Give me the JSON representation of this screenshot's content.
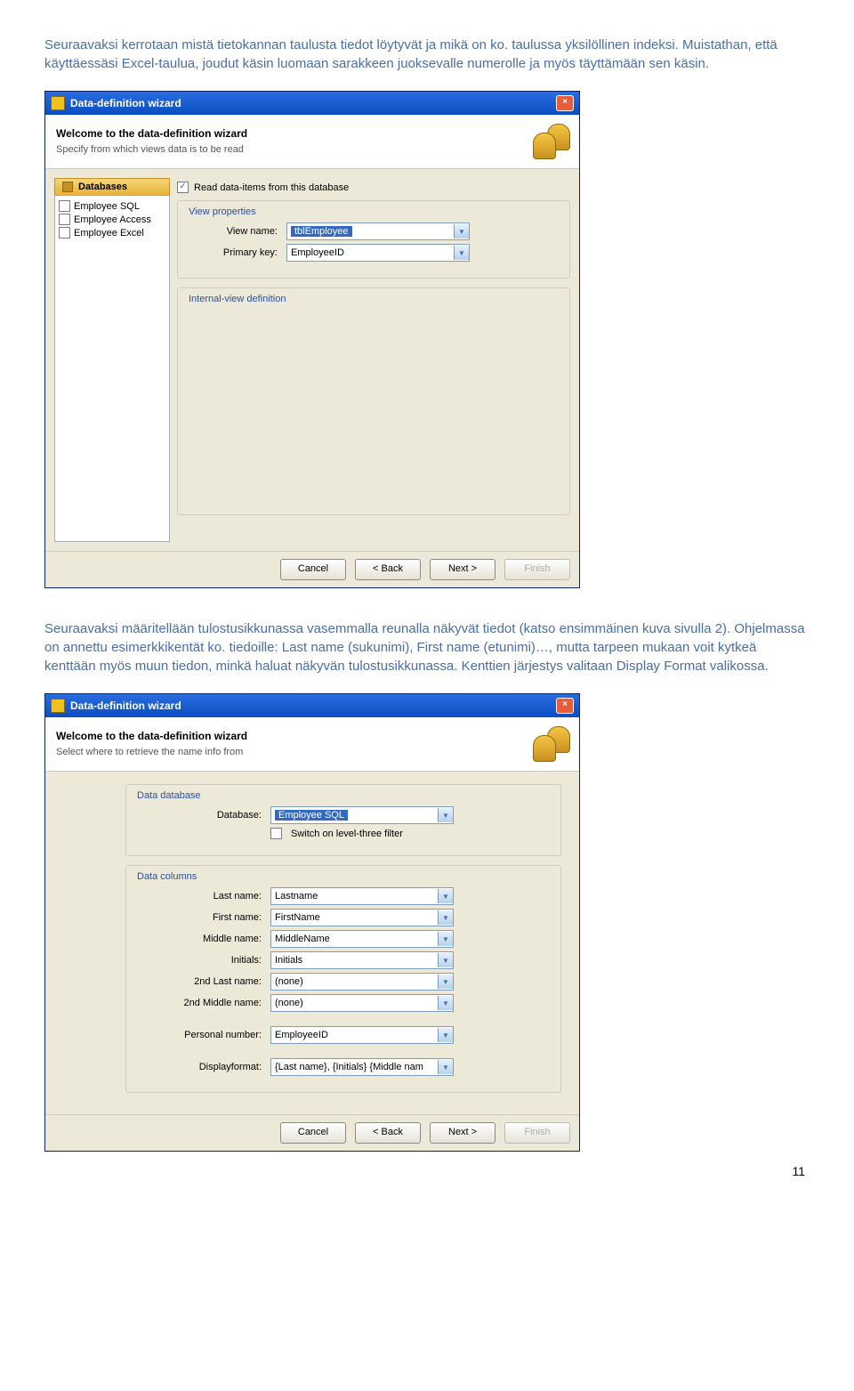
{
  "para1": "Seuraavaksi kerrotaan mistä tietokannan taulusta tiedot löytyvät ja mikä on ko. taulussa yksilöllinen indeksi. Muistathan, että käyttäessäsi Excel-taulua, joudut käsin luomaan sarakkeen juoksevalle numerolle ja myös täyttämään sen käsin.",
  "para2": "Seuraavaksi määritellään tulostusikkunassa vasemmalla reunalla näkyvät tiedot (katso ensimmäinen kuva sivulla 2). Ohjelmassa on annettu esimerkkikentät ko. tiedoille: Last name (sukunimi), First name (etunimi)…,  mutta tarpeen mukaan voit kytkeä kenttään myös muun tiedon, minkä haluat näkyvän tulostusikkunassa. Kenttien järjestys valitaan Display Format valikossa.",
  "page_num": "11",
  "win1": {
    "title": "Data-definition wizard",
    "h_title": "Welcome to the data-definition wizard",
    "h_sub": "Specify from which views data is to be read",
    "side_header": "Databases",
    "side_items": [
      "Employee SQL",
      "Employee Access",
      "Employee Excel"
    ],
    "read_cb": "Read data-items from this database",
    "grp1": "View properties",
    "view_name_l": "View name:",
    "view_name_v": "tblEmployee",
    "pk_l": "Primary key:",
    "pk_v": "EmployeeID",
    "grp2": "Internal-view definition"
  },
  "win2": {
    "title": "Data-definition wizard",
    "h_title": "Welcome to the data-definition wizard",
    "h_sub": "Select where to retrieve the name info from",
    "grp1": "Data database",
    "db_l": "Database:",
    "db_v": "Employee SQL",
    "switch_cb": "Switch on level-three filter",
    "grp2": "Data columns",
    "fields": [
      {
        "l": "Last name:",
        "v": "Lastname"
      },
      {
        "l": "First name:",
        "v": "FirstName"
      },
      {
        "l": "Middle name:",
        "v": "MiddleName"
      },
      {
        "l": "Initials:",
        "v": "Initials"
      },
      {
        "l": "2nd Last name:",
        "v": "(none)"
      },
      {
        "l": "2nd Middle name:",
        "v": "(none)"
      },
      {
        "l": "Personal number:",
        "v": "EmployeeID"
      },
      {
        "l": "Displayformat:",
        "v": "{Last name}, {Initials}  {Middle nam"
      }
    ]
  },
  "buttons": {
    "cancel": "Cancel",
    "back": "< Back",
    "next": "Next >",
    "finish": "Finish"
  }
}
